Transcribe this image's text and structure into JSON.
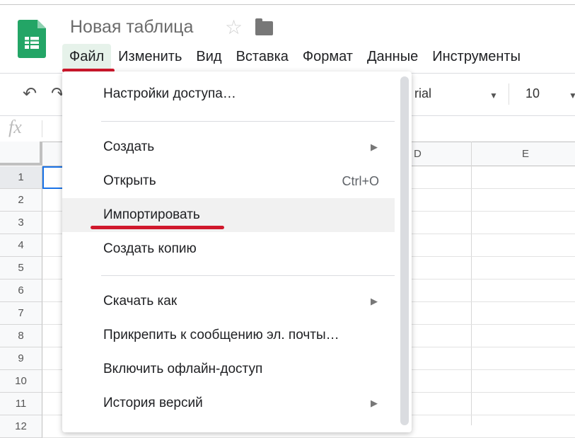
{
  "app": {
    "title": "Новая таблица",
    "brand_color": "#23a566",
    "accent_underline": "#d0182c"
  },
  "menubar": {
    "items": [
      "Файл",
      "Изменить",
      "Вид",
      "Вставка",
      "Формат",
      "Данные",
      "Инструменты"
    ],
    "active": "Файл"
  },
  "toolbar": {
    "font": "rial",
    "font_size": "10",
    "undo_icon": "undo-icon",
    "redo_icon": "redo-icon"
  },
  "formula": {
    "fx_label": "fx"
  },
  "sheet": {
    "columns": [
      "D",
      "E"
    ],
    "rows": [
      "1",
      "2",
      "3",
      "4",
      "5",
      "6",
      "7",
      "8",
      "9",
      "10",
      "11",
      "12"
    ]
  },
  "file_menu": {
    "items": [
      {
        "label": "Настройки доступа…"
      },
      {
        "label": "Создать",
        "submenu": true
      },
      {
        "label": "Открыть",
        "shortcut": "Ctrl+O"
      },
      {
        "label": "Импортировать",
        "highlighted": true
      },
      {
        "label": "Создать копию"
      },
      {
        "label": "Скачать как",
        "submenu": true
      },
      {
        "label": "Прикрепить к сообщению эл. почты…"
      },
      {
        "label": "Включить офлайн-доступ"
      },
      {
        "label": "История версий",
        "submenu": true
      }
    ]
  }
}
